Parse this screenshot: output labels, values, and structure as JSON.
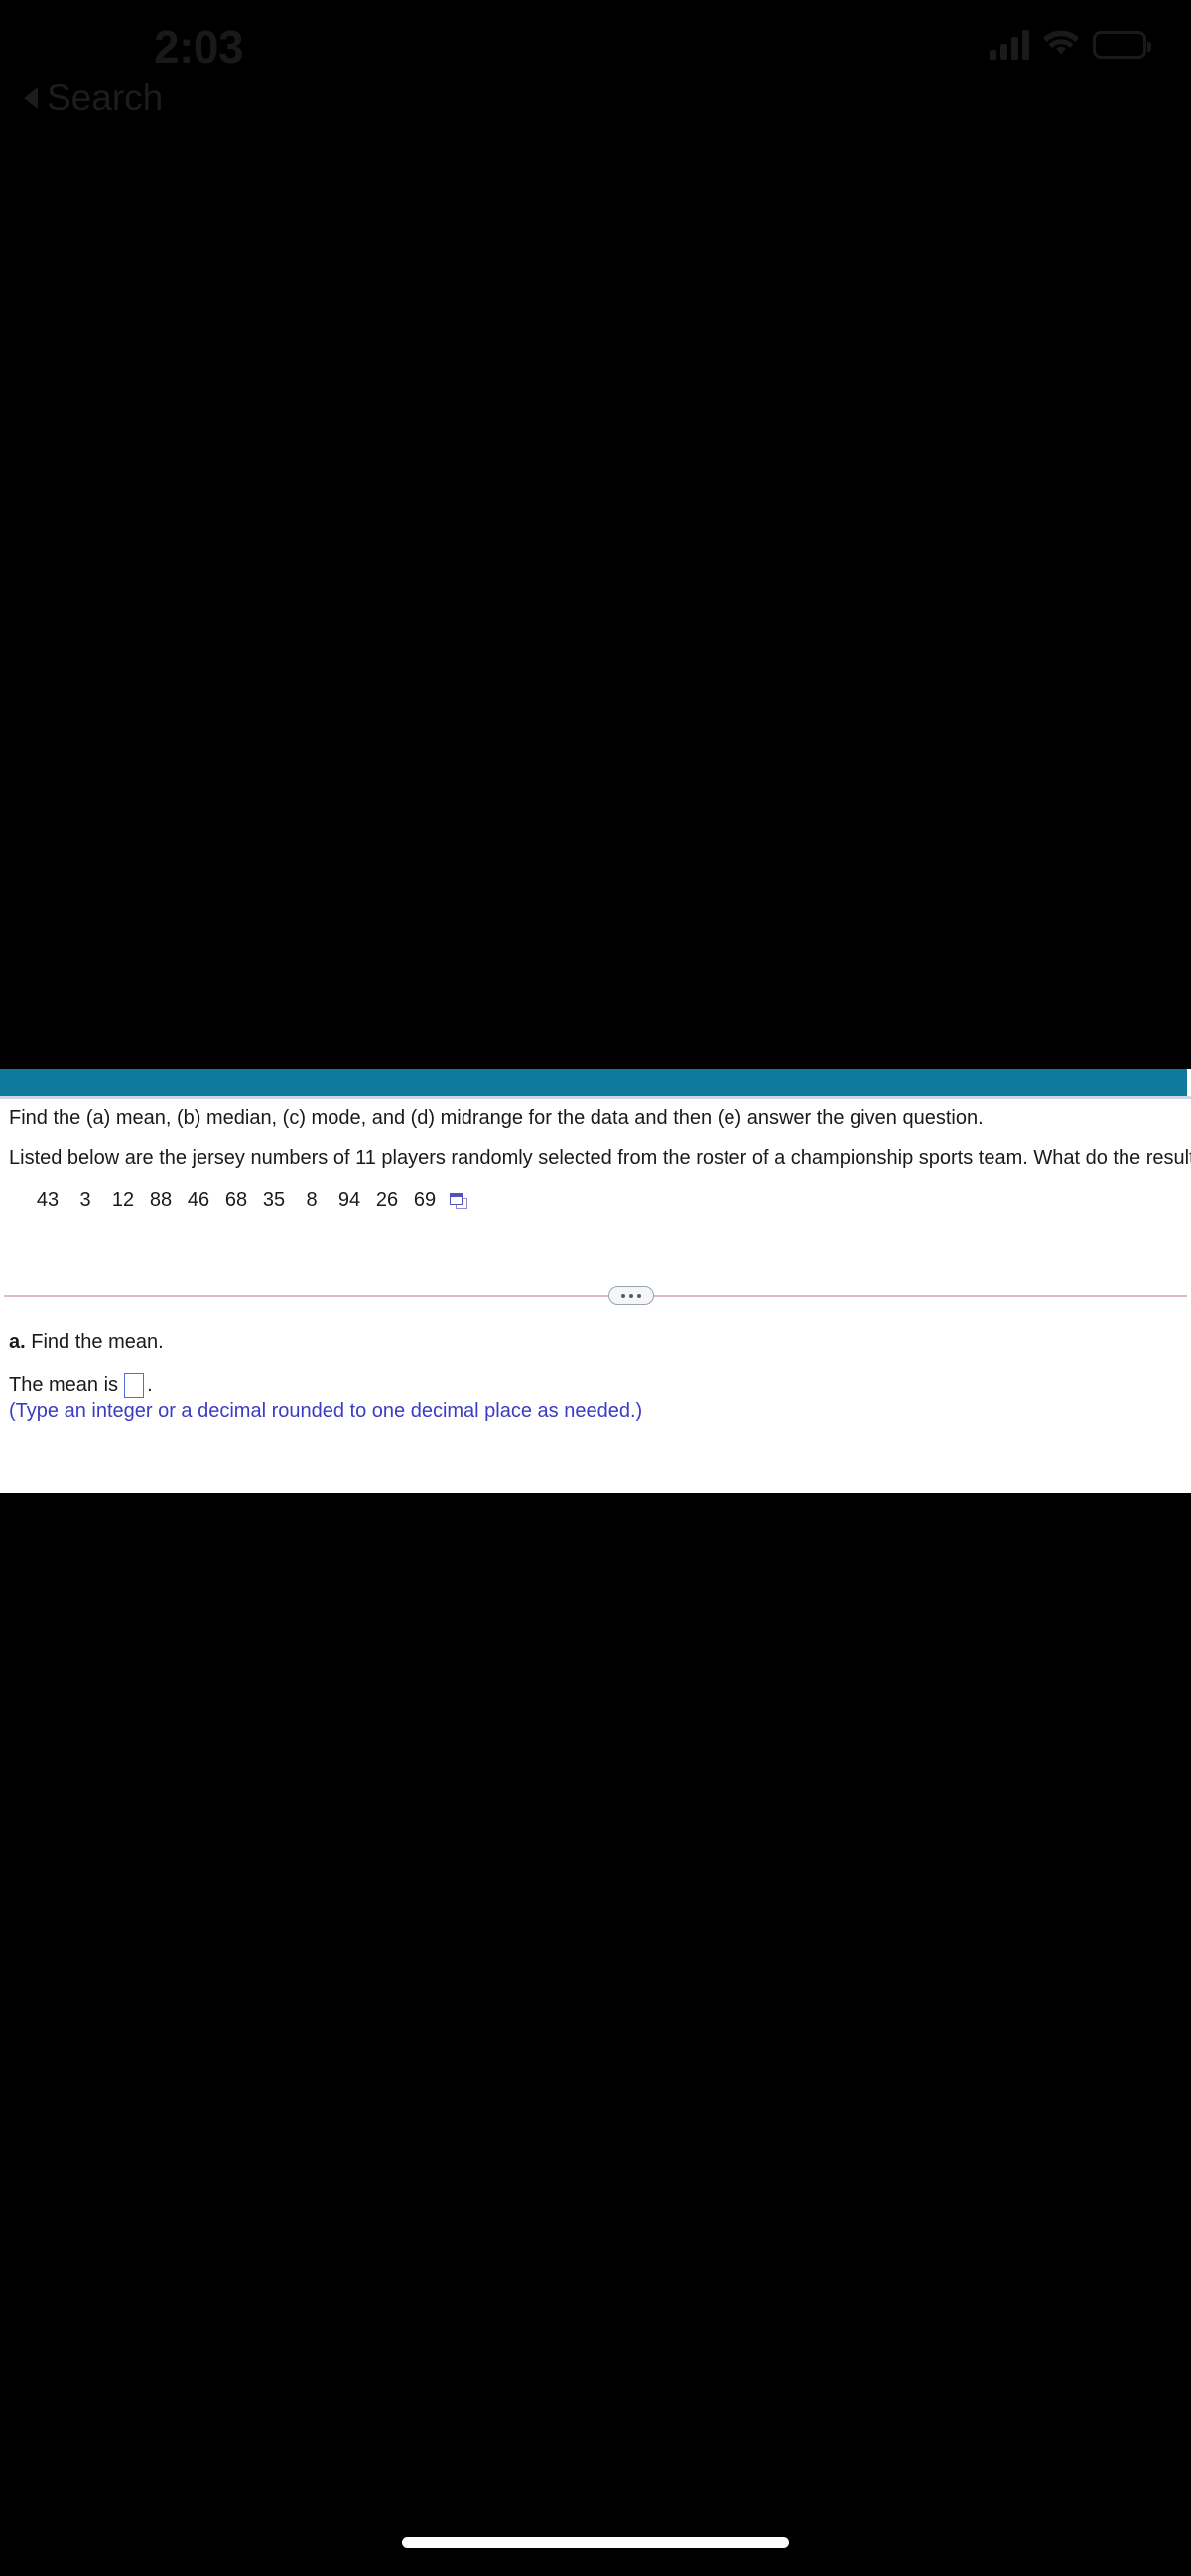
{
  "status_bar": {
    "time": "2:03",
    "signal_icon": "cellular-signal-icon",
    "wifi_icon": "wifi-icon",
    "battery_icon": "battery-icon"
  },
  "back_link": {
    "label": "Search",
    "icon": "back-triangle-icon"
  },
  "content": {
    "header_accent_color": "#0d7a9c",
    "question_line_1": "Find the (a) mean, (b) median, (c) mode, and (d) midrange for the data and then (e) answer the given question.",
    "question_line_2": "Listed below are the jersey numbers of 11 players randomly selected from the roster of a championship sports team. What do the results tell us?",
    "data_values": [
      "43",
      "3",
      "12",
      "88",
      "46",
      "68",
      "35",
      "8",
      "94",
      "26",
      "69"
    ],
    "popup_icon": "open-data-popup-icon",
    "divider_handle_icon": "expand-handle-dots-icon",
    "part_a_label": "a.",
    "part_a_text": "Find the mean.",
    "answer_prefix": "The mean is",
    "answer_suffix": ".",
    "answer_value": "",
    "answer_placeholder": "",
    "hint_text": "(Type an integer or a decimal rounded to one decimal place as needed.)",
    "hint_color": "#3b3bc4",
    "input_border_color": "#4f6fd6",
    "divider_color": "#e0b8c4"
  },
  "home_indicator": "home-indicator-bar"
}
